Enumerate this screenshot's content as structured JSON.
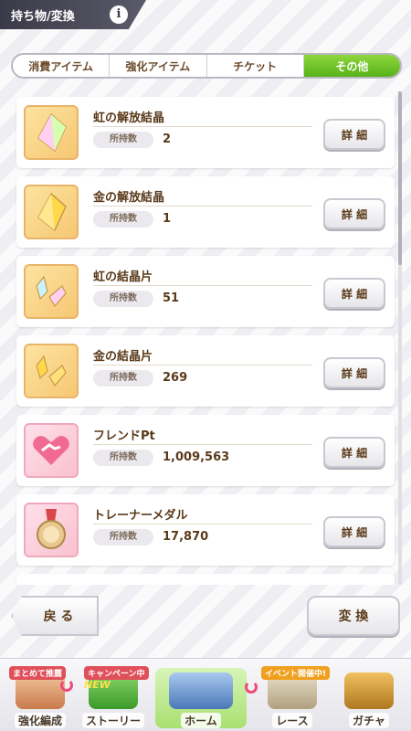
{
  "header": {
    "title": "持ち物/変換",
    "info_icon": "info-icon"
  },
  "tabs": [
    {
      "label": "消費アイテム",
      "active": false
    },
    {
      "label": "強化アイテム",
      "active": false
    },
    {
      "label": "チケット",
      "active": false
    },
    {
      "label": "その他",
      "active": true
    }
  ],
  "items": [
    {
      "name": "虹の解放結晶",
      "qty_label": "所持数",
      "qty": "2",
      "detail_label": "詳 細",
      "icon": "rainbow-crystal-icon"
    },
    {
      "name": "金の解放結晶",
      "qty_label": "所持数",
      "qty": "1",
      "detail_label": "詳 細",
      "icon": "gold-crystal-icon"
    },
    {
      "name": "虹の結晶片",
      "qty_label": "所持数",
      "qty": "51",
      "detail_label": "詳 細",
      "icon": "rainbow-shard-icon"
    },
    {
      "name": "金の結晶片",
      "qty_label": "所持数",
      "qty": "269",
      "detail_label": "詳 細",
      "icon": "gold-shard-icon"
    },
    {
      "name": "フレンドPt",
      "qty_label": "所持数",
      "qty": "1,009,563",
      "detail_label": "詳 細",
      "icon": "friend-point-icon"
    },
    {
      "name": "トレーナーメダル",
      "qty_label": "所持数",
      "qty": "17,870",
      "detail_label": "詳 細",
      "icon": "trainer-medal-icon"
    }
  ],
  "actions": {
    "back_label": "戻 る",
    "convert_label": "変 換"
  },
  "nav": [
    {
      "label": "強化編成",
      "badge": "まとめて推薦"
    },
    {
      "label": "ストーリー",
      "badge": "キャンペーン中",
      "new": "NEW"
    },
    {
      "label": "ホーム",
      "badge": ""
    },
    {
      "label": "レース",
      "badge": "イベント開催中!"
    },
    {
      "label": "ガチャ",
      "badge": ""
    }
  ],
  "colors": {
    "accent_green": "#58b21a",
    "text_brown": "#5a3a1a",
    "badge_red": "#e0505a"
  }
}
